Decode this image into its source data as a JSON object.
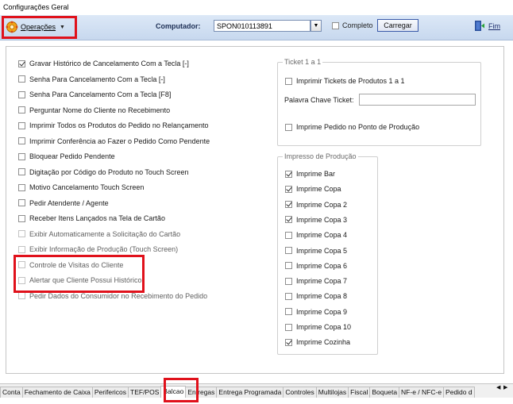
{
  "window": {
    "title": "Configurações Geral"
  },
  "toolbar": {
    "operacoes_label": "Operações",
    "computador_label": "Computador:",
    "computador_value": "SPON010113891",
    "completo_label": "Completo",
    "completo_checked": false,
    "carregar_label": "Carregar",
    "fim_label": "Fim"
  },
  "left_options": [
    {
      "label": "Gravar Histórico de Cancelamento Com a Tecla [-]",
      "checked": true,
      "enabled": true
    },
    {
      "label": "Senha Para Cancelamento Com a Tecla [-]",
      "checked": false,
      "enabled": true
    },
    {
      "label": "Senha Para Cancelamento Com a Tecla [F8]",
      "checked": false,
      "enabled": true
    },
    {
      "label": "Perguntar Nome do Cliente no Recebimento",
      "checked": false,
      "enabled": true
    },
    {
      "label": "Imprimir Todos os Produtos do Pedido no Relançamento",
      "checked": false,
      "enabled": true
    },
    {
      "label": "Imprimir Conferência ao Fazer o Pedido Como Pendente",
      "checked": false,
      "enabled": true
    },
    {
      "label": "Bloquear Pedido Pendente",
      "checked": false,
      "enabled": true
    },
    {
      "label": "Digitação por Código do Produto no Touch Screen",
      "checked": false,
      "enabled": true
    },
    {
      "label": "Motivo Cancelamento Touch Screen",
      "checked": false,
      "enabled": true
    },
    {
      "label": "Pedir Atendente / Agente",
      "checked": false,
      "enabled": true
    },
    {
      "label": "Receber Itens Lançados na Tela de Cartão",
      "checked": false,
      "enabled": true
    },
    {
      "label": "Exibir Automaticamente a Solicitação do Cartão",
      "checked": false,
      "enabled": false
    },
    {
      "label": "Exibir Informação de Produção (Touch Screen)",
      "checked": false,
      "enabled": false
    },
    {
      "label": "Controle de Visitas do Cliente",
      "checked": false,
      "enabled": false
    },
    {
      "label": "Alertar que Cliente Possui Histórico",
      "checked": false,
      "enabled": false
    },
    {
      "label": "Pedir Dados do Consumidor no Recebimento do Pedido",
      "checked": false,
      "enabled": false
    }
  ],
  "ticket_group": {
    "title": "Ticket 1 a 1",
    "imprimir_tickets": {
      "label": "Imprimir Tickets de Produtos 1 a 1",
      "checked": false
    },
    "palavra_chave_label": "Palavra Chave Ticket:",
    "palavra_chave_value": "",
    "imprime_pedido": {
      "label": "Imprime Pedido no Ponto de Produção",
      "checked": false
    }
  },
  "impresso_group": {
    "title": "Impresso de Produção",
    "items": [
      {
        "label": "Imprime Bar",
        "checked": true
      },
      {
        "label": "Imprime Copa",
        "checked": true
      },
      {
        "label": "Imprime Copa 2",
        "checked": true
      },
      {
        "label": "Imprime Copa 3",
        "checked": true
      },
      {
        "label": "Imprime Copa 4",
        "checked": false
      },
      {
        "label": "Imprime Copa 5",
        "checked": false
      },
      {
        "label": "Imprime Copa 6",
        "checked": false
      },
      {
        "label": "Imprime Copa 7",
        "checked": false
      },
      {
        "label": "Imprime Copa 8",
        "checked": false
      },
      {
        "label": "Imprime Copa 9",
        "checked": false
      },
      {
        "label": "Imprime Copa 10",
        "checked": false
      },
      {
        "label": "Imprime Cozinha",
        "checked": true
      }
    ]
  },
  "tabs": [
    {
      "label": "Conta"
    },
    {
      "label": "Fechamento de Caixa"
    },
    {
      "label": "Perifericos"
    },
    {
      "label": "TEF/POS"
    },
    {
      "label": "Balcao",
      "active": true
    },
    {
      "label": "Entregas"
    },
    {
      "label": "Entrega Programada"
    },
    {
      "label": "Controles"
    },
    {
      "label": "Multilojas"
    },
    {
      "label": "Fiscal"
    },
    {
      "label": "Boqueta"
    },
    {
      "label": "NF-e / NFC-e"
    },
    {
      "label": "Pedido d"
    }
  ],
  "colors": {
    "highlight": "#e0111b",
    "toolbar": "#dce8f7"
  }
}
